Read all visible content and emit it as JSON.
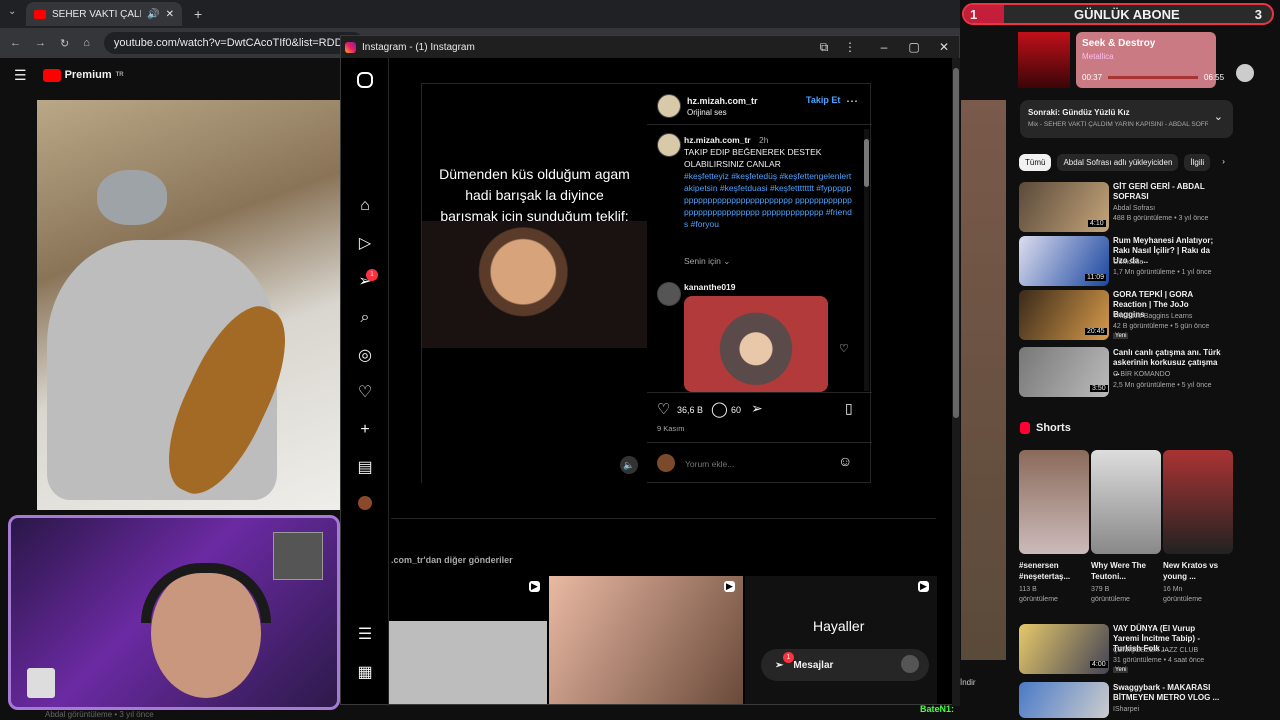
{
  "browser": {
    "tab_title": "SEHER VAKTİ ÇALDIM YARİ",
    "url": "youtube.com/watch?v=DwtCAcoTIf0&list=RDDwtC",
    "yt_logo": "Premium",
    "yt_logo_sup": "TR"
  },
  "overlay": {
    "rank": "1",
    "label": "GÜNLÜK ABONE",
    "count": "3",
    "chat_user": "BateN1:"
  },
  "music": {
    "title": "Seek & Destroy",
    "artist": "Metallica",
    "elapsed": "00:37",
    "total": "06:55"
  },
  "playlist": {
    "next": "Sonraki: Gündüz Yüzlü Kız",
    "sub": "Mix - SEHER VAKTİ ÇALDIM YARİN KAPİSİNİ - ABDAL SOFR..."
  },
  "chips": [
    "Tümü",
    "Abdal Sofrası adlı yükleyiciden",
    "İlgili"
  ],
  "related": [
    {
      "title": "GİT GERİ GERİ - ABDAL SOFRASI",
      "channel": "Abdal Sofrası",
      "meta": "488 B görüntüleme • 3 yıl önce",
      "dur": "4:10"
    },
    {
      "title": "Rum Meyhanesi Anlatıyor; Rakı Nasıl İçilir? | Rakı da Uzo da ...",
      "channel": "Gumoose",
      "meta": "1,7 Mn görüntüleme • 1 yıl önce",
      "dur": "11:09"
    },
    {
      "title": "GORA TEPKİ | GORA Reaction | The JoJo Baggins",
      "channel": "The JoJo Baggins Learns",
      "meta": "42 B görüntüleme • 5 gün önce",
      "dur": "20:45",
      "badge": "Yeni"
    },
    {
      "title": "Canlı canlı çatışma anı. Türk askerinin korkusuz çatışma ...",
      "channel": "O BİR KOMANDO",
      "meta": "2,5 Mn görüntüleme • 5 yıl önce",
      "dur": "3:50"
    }
  ],
  "shorts": {
    "header": "Shorts",
    "items": [
      {
        "title": "#senersen #neşetertaş...",
        "views": "113 B görüntüleme"
      },
      {
        "title": "Why Were The Teutoni...",
        "views": "379 B görüntüleme"
      },
      {
        "title": "New Kratos vs young ...",
        "views": "16 Mn görüntüleme"
      }
    ]
  },
  "related2": [
    {
      "title": "VAY DÜNYA (El Vurup Yaremi İncitme Tabip) - Turkish Folk ...",
      "channel": "ÇEMİŞGEZEK JAZZ CLUB",
      "meta": "31 görüntüleme • 4 saat önce",
      "dur": "4:00",
      "badge": "Yeni"
    },
    {
      "title": "Swaggybark - MAKARASI BİTMEYEN METRO VLOG ...",
      "channel": "ISharpei",
      "meta": "",
      "dur": ""
    }
  ],
  "instagram": {
    "window_title": "Instagram - (1) Instagram",
    "notif_count": "1",
    "author": "hz.mizah.com_tr",
    "follow": "Takip Et",
    "audio": "Orijinal ses",
    "caption_time": "2h",
    "caption": "TAKIP EDIP BEĞENEREK DESTEK OLABILIRSINIZ CANLAR",
    "hashtags": "#keşfetteyiz #keşfetedüş #keşfettengelenlertakipetsin #keşfetduasi #keşfetttttttt #fypppppppppppppppppppppppppppp pppppppppppppppppppppppppppp ppppppppppppp #friends #foryou",
    "for_you": "Senin için",
    "commenter": "kananthe019",
    "likes": "36,6 B",
    "comments": "60",
    "date": "9 Kasım",
    "comment_placeholder": "Yorum ekle...",
    "meme_line1": "Dümenden küs olduğum agam",
    "meme_line2": "hadi barışak la diyince",
    "meme_line3": "barışmak için sunduğum teklif:",
    "more_from": ".com_tr'dan diğer gönderiler",
    "grid3_text": "Hayaller",
    "messages": "Mesajlar"
  },
  "under_video": "Abdal görüntüleme • 3 yıl önce",
  "dislike_label": "İndir"
}
